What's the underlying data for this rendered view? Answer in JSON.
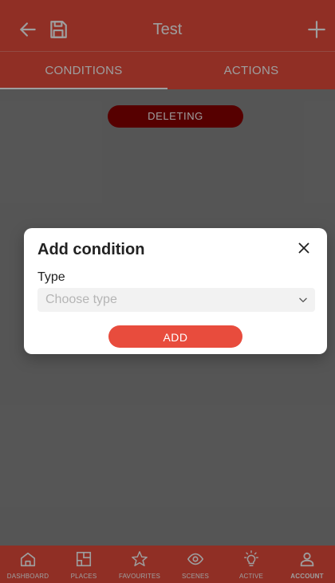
{
  "colors": {
    "primary": "#e84c3d",
    "deleting_bg": "#8b0000",
    "background": "#ffffff"
  },
  "appbar": {
    "title": "Test",
    "back_icon": "arrow-left-icon",
    "save_icon": "save-icon",
    "add_icon": "plus-icon"
  },
  "tabs": [
    {
      "label": "CONDITIONS",
      "active": true
    },
    {
      "label": "ACTIONS",
      "active": false
    }
  ],
  "main": {
    "deleting_label": "DELETING"
  },
  "modal": {
    "title": "Add condition",
    "close_icon": "close-icon",
    "type_label": "Type",
    "select_placeholder": "Choose type",
    "select_icon": "chevron-down-icon",
    "add_label": "ADD"
  },
  "bottom_nav": {
    "items": [
      {
        "label": "DASHBOARD",
        "icon": "home-icon",
        "active": false
      },
      {
        "label": "PLACES",
        "icon": "floorplan-icon",
        "active": false
      },
      {
        "label": "FAVOURITES",
        "icon": "star-icon",
        "active": false
      },
      {
        "label": "SCENES",
        "icon": "eye-icon",
        "active": false
      },
      {
        "label": "ACTIVE",
        "icon": "lightbulb-icon",
        "active": false
      },
      {
        "label": "ACCOUNT",
        "icon": "account-icon",
        "active": true
      }
    ]
  }
}
